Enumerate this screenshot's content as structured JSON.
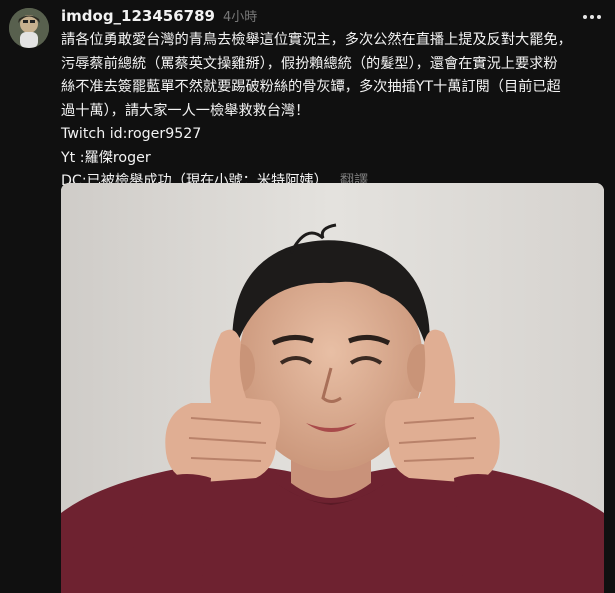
{
  "post": {
    "username": "imdog_123456789",
    "timestamp": "4小時",
    "body_lines": [
      "請各位勇敢愛台灣的青鳥去檢舉這位實況主，多次公然在直播上提及反對大罷免，",
      "污辱蔡前總統（罵蔡英文操雞掰），假扮賴總統（的髮型），還會在實況上要求粉",
      "絲不准去簽罷藍單不然就要踢破粉絲的骨灰罈，多次抽插YT十萬訂閱（目前已超",
      "過十萬），請大家一人一檢舉救救台灣！",
      "Twitch id:roger9527",
      "Yt :羅傑roger",
      "DC:已被檢舉成功（現在小號：米特阿姨）"
    ],
    "translate_label": "翻譯"
  },
  "icons": {
    "avatar": "user-avatar",
    "more": "more-options-icon"
  },
  "colors": {
    "background": "#101010",
    "text_primary": "#f3f3f3",
    "text_secondary": "#777777",
    "shirt": "#7a2430"
  }
}
